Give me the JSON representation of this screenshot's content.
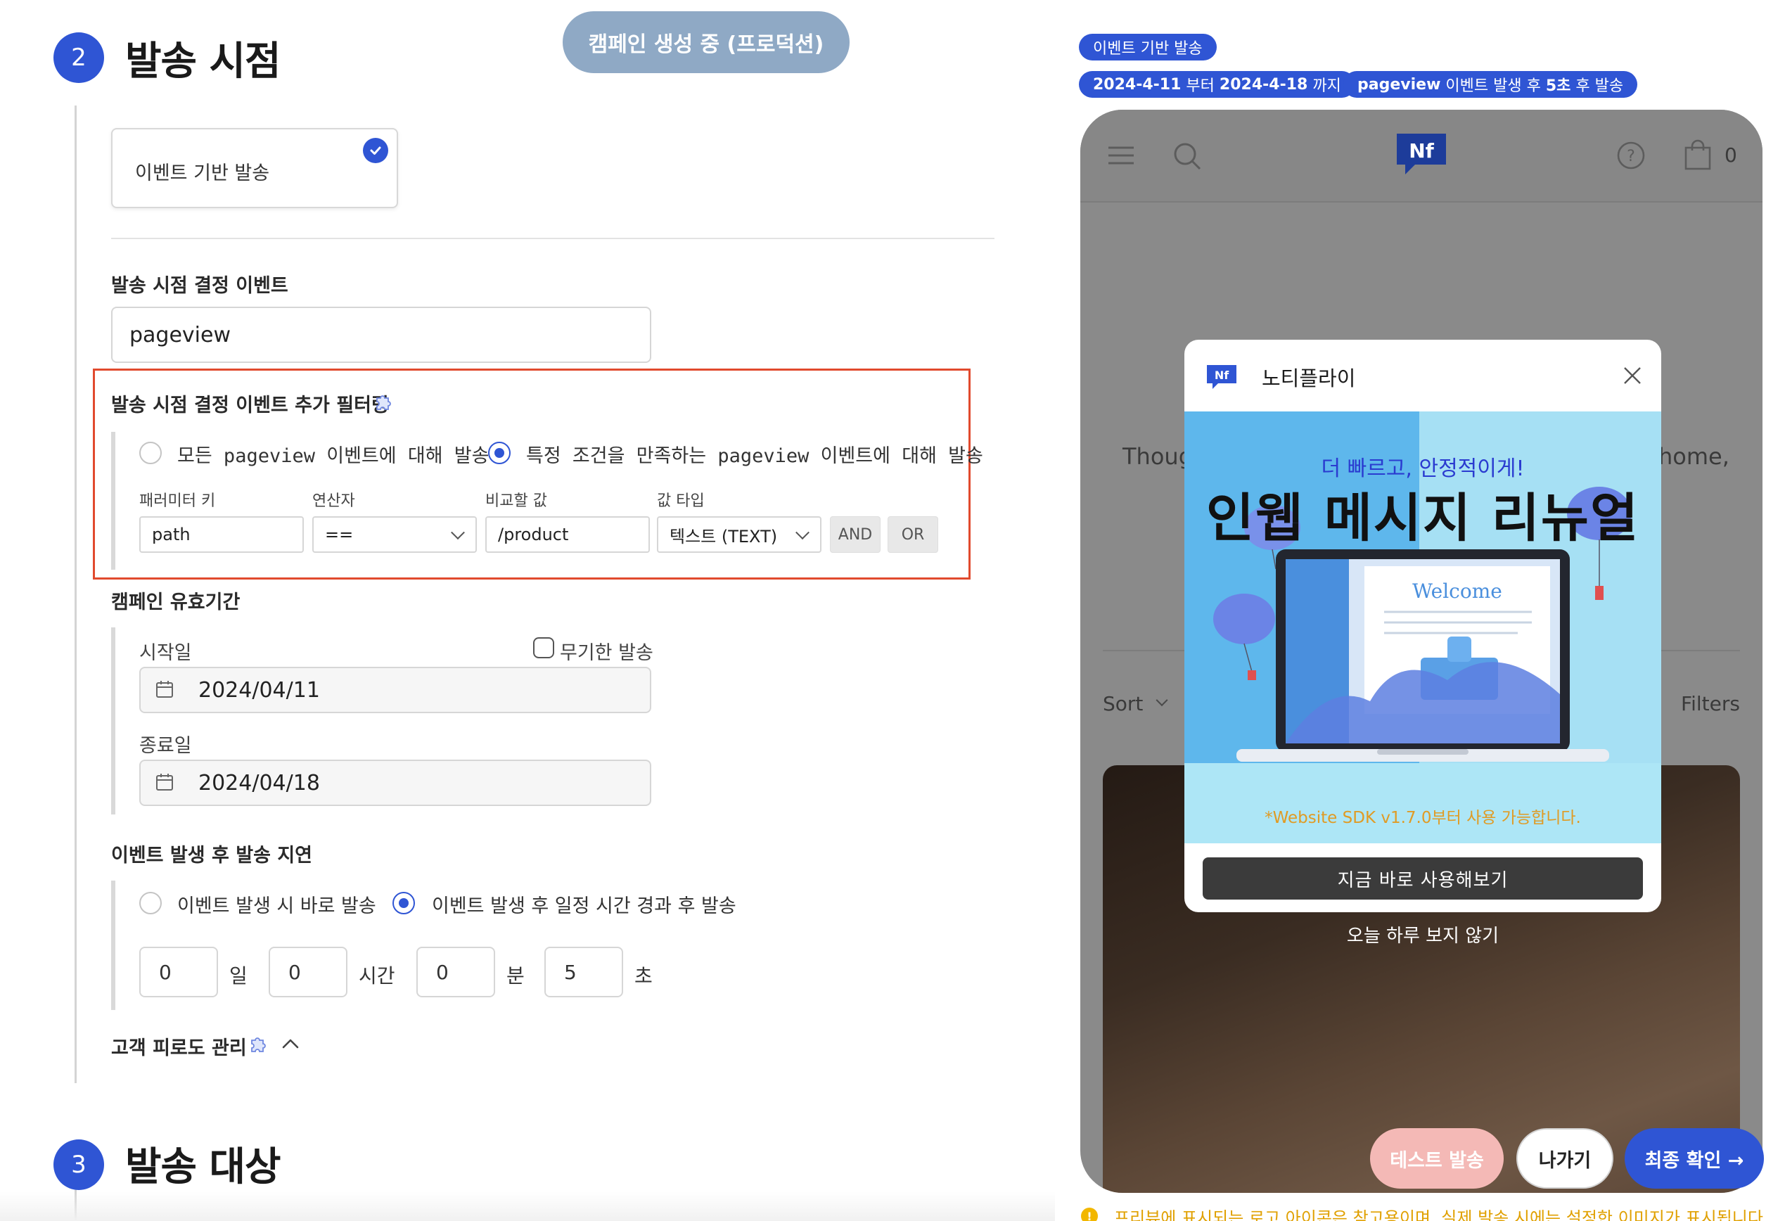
{
  "status_pill": "캠페인 생성 중 (프로덕션)",
  "section2": {
    "number": "2",
    "title": "발송 시점",
    "trigger_card": {
      "label": "이벤트 기반 발송",
      "selected": true
    },
    "event_label": "발송 시점 결정 이벤트",
    "event_value": "pageview",
    "filter": {
      "label": "발송 시점 결정 이벤트 추가 필터링",
      "radio_all": "모든 pageview 이벤트에 대해 발송",
      "radio_specific": "특정 조건을 만족하는 pageview 이벤트에 대해 발송",
      "selected": "specific",
      "col_param_key": "패러미터 키",
      "col_operator": "연산자",
      "col_compare_value": "비교할 값",
      "col_value_type": "값 타입",
      "param_key_value": "path",
      "operator_value": "==",
      "compare_value": "/product",
      "value_type_value": "텍스트 (TEXT)",
      "and_button": "AND",
      "or_button": "OR"
    },
    "validity": {
      "label": "캠페인 유효기간",
      "start_label": "시작일",
      "unlimited_label": "무기한 발송",
      "unlimited_checked": false,
      "start_value": "2024/04/11",
      "end_label": "종료일",
      "end_value": "2024/04/18"
    },
    "delay": {
      "label": "이벤트 발생 후 발송 지연",
      "radio_immediate": "이벤트 발생 시 바로 발송",
      "radio_after": "이벤트 발생 후 일정 시간 경과 후 발송",
      "selected": "after",
      "days": "0",
      "days_unit": "일",
      "hours": "0",
      "hours_unit": "시간",
      "minutes": "0",
      "minutes_unit": "분",
      "seconds": "5",
      "seconds_unit": "초"
    },
    "fatigue_label": "고객 피로도 관리"
  },
  "section3": {
    "number": "3",
    "title": "발송 대상"
  },
  "preview": {
    "tags": {
      "trigger": "이벤트 기반 발송",
      "period_start": "2024-4-11",
      "period_from": "부터",
      "period_end": "2024-4-18",
      "period_until": "까지",
      "event_name": "pageview",
      "event_middle": "이벤트 발생 후",
      "delay_value": "5초",
      "event_end": "후 발송"
    },
    "cart_count": "0",
    "body_left": "Thoug",
    "body_right": "home,",
    "sort_label": "Sort",
    "filters_label": "Filters",
    "modal": {
      "title": "노티플라이",
      "banner_sub": "더 빠르고, 안정적이게!",
      "banner_main": "인웹 메시지 리뉴얼",
      "laptop_welcome": "Welcome",
      "banner_note": "*Website SDK v1.7.0부터 사용 가능합니다.",
      "cta": "지금 바로 사용해보기"
    },
    "dont_show": "오늘 하루 보지 않기",
    "notice": "프리뷰에 표시되는 로고 아이콘은 참고용이며, 실제 발송 시에는 설정한 이미지가 표시됩니다."
  },
  "actions": {
    "test_send": "테스트 발송",
    "exit": "나가기",
    "final_confirm": "최종 확인 →"
  },
  "colors": {
    "primary": "#2f55d4",
    "status_pill": "#8fa9c5",
    "highlight_border": "#e14a2e",
    "test_send_bg": "#f4b9b6",
    "banner_bg": "#a6e0f4",
    "note_orange": "#e09b24"
  }
}
